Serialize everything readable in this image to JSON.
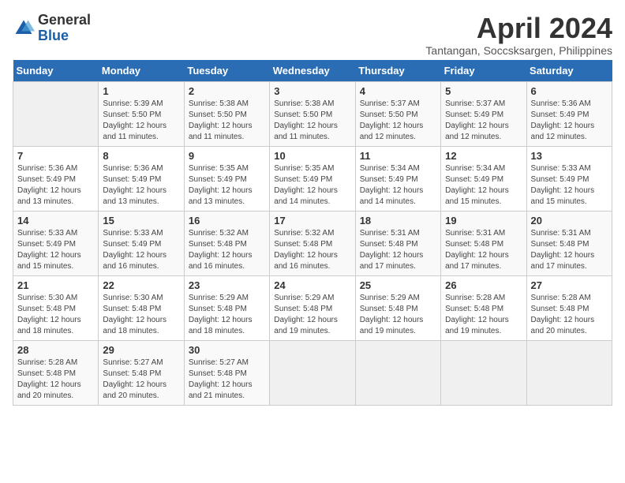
{
  "header": {
    "logo_general": "General",
    "logo_blue": "Blue",
    "month_title": "April 2024",
    "location": "Tantangan, Soccsksargen, Philippines"
  },
  "days_of_week": [
    "Sunday",
    "Monday",
    "Tuesday",
    "Wednesday",
    "Thursday",
    "Friday",
    "Saturday"
  ],
  "weeks": [
    [
      {
        "day": "",
        "info": ""
      },
      {
        "day": "1",
        "info": "Sunrise: 5:39 AM\nSunset: 5:50 PM\nDaylight: 12 hours\nand 11 minutes."
      },
      {
        "day": "2",
        "info": "Sunrise: 5:38 AM\nSunset: 5:50 PM\nDaylight: 12 hours\nand 11 minutes."
      },
      {
        "day": "3",
        "info": "Sunrise: 5:38 AM\nSunset: 5:50 PM\nDaylight: 12 hours\nand 11 minutes."
      },
      {
        "day": "4",
        "info": "Sunrise: 5:37 AM\nSunset: 5:50 PM\nDaylight: 12 hours\nand 12 minutes."
      },
      {
        "day": "5",
        "info": "Sunrise: 5:37 AM\nSunset: 5:49 PM\nDaylight: 12 hours\nand 12 minutes."
      },
      {
        "day": "6",
        "info": "Sunrise: 5:36 AM\nSunset: 5:49 PM\nDaylight: 12 hours\nand 12 minutes."
      }
    ],
    [
      {
        "day": "7",
        "info": "Sunrise: 5:36 AM\nSunset: 5:49 PM\nDaylight: 12 hours\nand 13 minutes."
      },
      {
        "day": "8",
        "info": "Sunrise: 5:36 AM\nSunset: 5:49 PM\nDaylight: 12 hours\nand 13 minutes."
      },
      {
        "day": "9",
        "info": "Sunrise: 5:35 AM\nSunset: 5:49 PM\nDaylight: 12 hours\nand 13 minutes."
      },
      {
        "day": "10",
        "info": "Sunrise: 5:35 AM\nSunset: 5:49 PM\nDaylight: 12 hours\nand 14 minutes."
      },
      {
        "day": "11",
        "info": "Sunrise: 5:34 AM\nSunset: 5:49 PM\nDaylight: 12 hours\nand 14 minutes."
      },
      {
        "day": "12",
        "info": "Sunrise: 5:34 AM\nSunset: 5:49 PM\nDaylight: 12 hours\nand 15 minutes."
      },
      {
        "day": "13",
        "info": "Sunrise: 5:33 AM\nSunset: 5:49 PM\nDaylight: 12 hours\nand 15 minutes."
      }
    ],
    [
      {
        "day": "14",
        "info": "Sunrise: 5:33 AM\nSunset: 5:49 PM\nDaylight: 12 hours\nand 15 minutes."
      },
      {
        "day": "15",
        "info": "Sunrise: 5:33 AM\nSunset: 5:49 PM\nDaylight: 12 hours\nand 16 minutes."
      },
      {
        "day": "16",
        "info": "Sunrise: 5:32 AM\nSunset: 5:48 PM\nDaylight: 12 hours\nand 16 minutes."
      },
      {
        "day": "17",
        "info": "Sunrise: 5:32 AM\nSunset: 5:48 PM\nDaylight: 12 hours\nand 16 minutes."
      },
      {
        "day": "18",
        "info": "Sunrise: 5:31 AM\nSunset: 5:48 PM\nDaylight: 12 hours\nand 17 minutes."
      },
      {
        "day": "19",
        "info": "Sunrise: 5:31 AM\nSunset: 5:48 PM\nDaylight: 12 hours\nand 17 minutes."
      },
      {
        "day": "20",
        "info": "Sunrise: 5:31 AM\nSunset: 5:48 PM\nDaylight: 12 hours\nand 17 minutes."
      }
    ],
    [
      {
        "day": "21",
        "info": "Sunrise: 5:30 AM\nSunset: 5:48 PM\nDaylight: 12 hours\nand 18 minutes."
      },
      {
        "day": "22",
        "info": "Sunrise: 5:30 AM\nSunset: 5:48 PM\nDaylight: 12 hours\nand 18 minutes."
      },
      {
        "day": "23",
        "info": "Sunrise: 5:29 AM\nSunset: 5:48 PM\nDaylight: 12 hours\nand 18 minutes."
      },
      {
        "day": "24",
        "info": "Sunrise: 5:29 AM\nSunset: 5:48 PM\nDaylight: 12 hours\nand 19 minutes."
      },
      {
        "day": "25",
        "info": "Sunrise: 5:29 AM\nSunset: 5:48 PM\nDaylight: 12 hours\nand 19 minutes."
      },
      {
        "day": "26",
        "info": "Sunrise: 5:28 AM\nSunset: 5:48 PM\nDaylight: 12 hours\nand 19 minutes."
      },
      {
        "day": "27",
        "info": "Sunrise: 5:28 AM\nSunset: 5:48 PM\nDaylight: 12 hours\nand 20 minutes."
      }
    ],
    [
      {
        "day": "28",
        "info": "Sunrise: 5:28 AM\nSunset: 5:48 PM\nDaylight: 12 hours\nand 20 minutes."
      },
      {
        "day": "29",
        "info": "Sunrise: 5:27 AM\nSunset: 5:48 PM\nDaylight: 12 hours\nand 20 minutes."
      },
      {
        "day": "30",
        "info": "Sunrise: 5:27 AM\nSunset: 5:48 PM\nDaylight: 12 hours\nand 21 minutes."
      },
      {
        "day": "",
        "info": ""
      },
      {
        "day": "",
        "info": ""
      },
      {
        "day": "",
        "info": ""
      },
      {
        "day": "",
        "info": ""
      }
    ]
  ]
}
